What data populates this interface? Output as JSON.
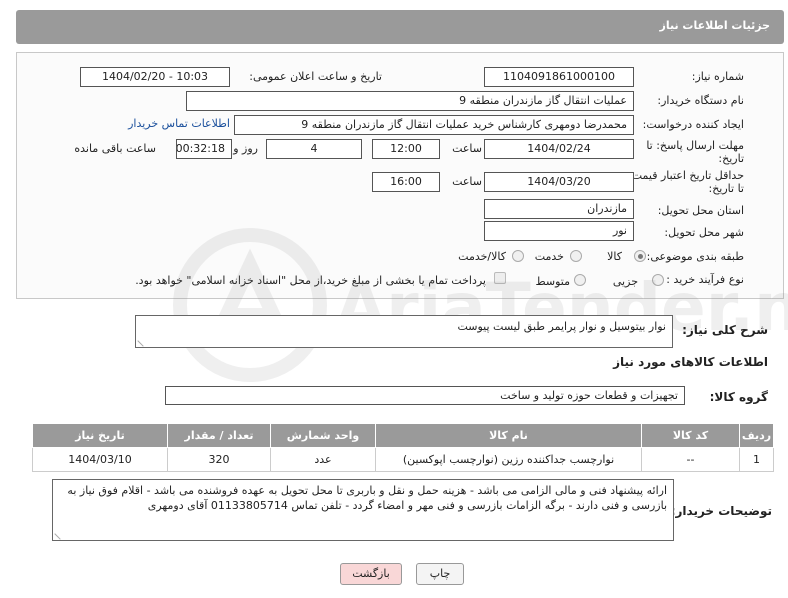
{
  "header": {
    "title": "جزئیات اطلاعات نیاز"
  },
  "form": {
    "need_number_label": "شماره نیاز:",
    "need_number": "1104091861000100",
    "announce_label": "تاریخ و ساعت اعلان عمومی:",
    "announce_value": "1404/02/20 - 10:03",
    "buyer_org_label": "نام دستگاه خریدار:",
    "buyer_org": "عملیات انتقال گاز مازندران منطقه 9",
    "creator_label": "ایجاد کننده درخواست:",
    "creator": "محمدرضا دومهری کارشناس خرید عملیات انتقال گاز مازندران منطقه 9",
    "contact_link": "اطلاعات تماس خریدار",
    "reply_deadline_label_1": "مهلت ارسال پاسخ: تا",
    "reply_deadline_label_2": "تاریخ:",
    "reply_date": "1404/02/24",
    "time_label": "ساعت",
    "reply_time": "12:00",
    "days": "4",
    "days_label": "روز و",
    "remaining": "00:32:18",
    "remaining_label": "ساعت باقی مانده",
    "price_validity_label_1": "حداقل تاریخ اعتبار قیمت:",
    "price_validity_label_2": "تا تاریخ:",
    "price_date": "1404/03/20",
    "price_time": "16:00",
    "province_label": "استان محل تحویل:",
    "province": "مازندران",
    "city_label": "شهر محل تحویل:",
    "city": "نور",
    "category_label": "طبقه بندی موضوعی:",
    "category_options": [
      "کالا",
      "خدمت",
      "کالا/خدمت"
    ],
    "process_label": "نوع فرآیند خرید :",
    "process_options": [
      "جزیی",
      "متوسط"
    ],
    "payment_note": "پرداخت تمام یا بخشی از مبلغ خرید،از محل \"اسناد خزانه اسلامی\" خواهد بود."
  },
  "description": {
    "label": "شرح کلی نیاز:",
    "value": "نوار بیتوسیل و نوار پرایمر طبق لیست پیوست"
  },
  "goods": {
    "section_title": "اطلاعات کالاهای مورد نیاز",
    "group_label": "گروه کالا:",
    "group_value": "تجهیزات و قطعات حوزه تولید و ساخت",
    "columns": [
      "ردیف",
      "کد کالا",
      "نام کالا",
      "واحد شمارش",
      "تعداد / مقدار",
      "تاریخ نیاز"
    ],
    "rows": [
      [
        "1",
        "--",
        "نوارچسب جداکننده رزین (نوارچسب اپوکسین)",
        "عدد",
        "320",
        "1404/03/10"
      ]
    ]
  },
  "buyer_notes": {
    "label": "توضیحات خریدار:",
    "value": "ارائه پیشنهاد فنی و مالی الزامی می باشد - هزینه حمل و نقل و باربری تا محل تحویل به عهده فروشنده می باشد - اقلام فوق نیاز به بازرسی و فنی دارند - برگه الزامات بازرسی و فنی مهر و امضاء گردد - تلفن تماس 01133805714 آقای دومهری"
  },
  "buttons": {
    "print": "چاپ",
    "back": "بازگشت"
  },
  "watermark": {
    "text": "AriaTender.net"
  },
  "colors": {
    "header_bg": "#9a9a9a",
    "link": "#1a4f9c",
    "back_bg": "#f9d7d7"
  }
}
